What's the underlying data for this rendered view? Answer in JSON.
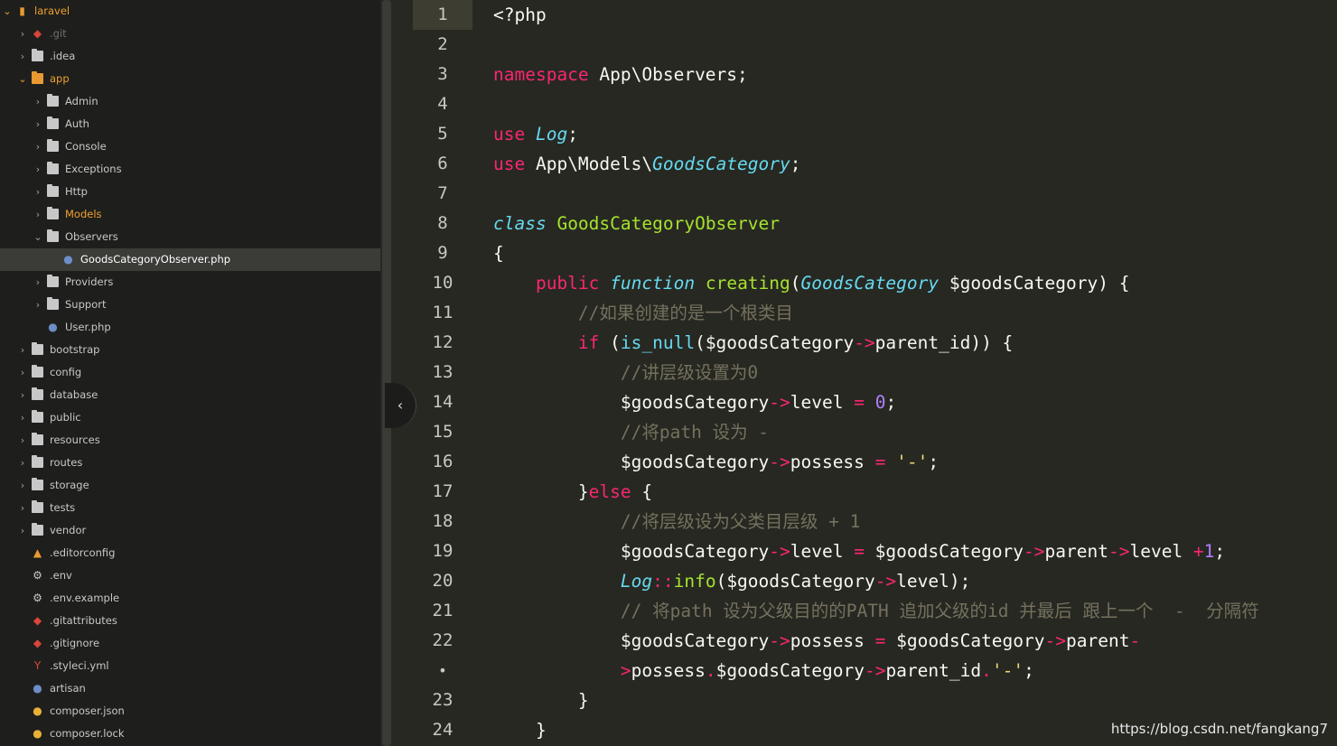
{
  "sidebar": {
    "items": [
      {
        "label": "laravel",
        "arrow": "⌄",
        "icon": "book-icon"
      },
      {
        "label": ".git",
        "arrow": "›",
        "icon": "git-icon"
      },
      {
        "label": ".idea",
        "arrow": "›",
        "icon": "folder-icon"
      },
      {
        "label": "app",
        "arrow": "⌄",
        "icon": "folder-open-icon"
      },
      {
        "label": "Admin",
        "arrow": "›",
        "icon": "folder-icon"
      },
      {
        "label": "Auth",
        "arrow": "›",
        "icon": "folder-icon"
      },
      {
        "label": "Console",
        "arrow": "›",
        "icon": "folder-icon"
      },
      {
        "label": "Exceptions",
        "arrow": "›",
        "icon": "folder-icon"
      },
      {
        "label": "Http",
        "arrow": "›",
        "icon": "folder-icon"
      },
      {
        "label": "Models",
        "arrow": "›",
        "icon": "folder-icon"
      },
      {
        "label": "Observers",
        "arrow": "⌄",
        "icon": "folder-icon"
      },
      {
        "label": "GoodsCategoryObserver.php",
        "arrow": "",
        "icon": "php-elephant-icon"
      },
      {
        "label": "Providers",
        "arrow": "›",
        "icon": "folder-icon"
      },
      {
        "label": "Support",
        "arrow": "›",
        "icon": "folder-icon"
      },
      {
        "label": "User.php",
        "arrow": "",
        "icon": "php-elephant-icon"
      },
      {
        "label": "bootstrap",
        "arrow": "›",
        "icon": "folder-icon"
      },
      {
        "label": "config",
        "arrow": "›",
        "icon": "folder-icon"
      },
      {
        "label": "database",
        "arrow": "›",
        "icon": "folder-icon"
      },
      {
        "label": "public",
        "arrow": "›",
        "icon": "folder-icon"
      },
      {
        "label": "resources",
        "arrow": "›",
        "icon": "folder-icon"
      },
      {
        "label": "routes",
        "arrow": "›",
        "icon": "folder-icon"
      },
      {
        "label": "storage",
        "arrow": "›",
        "icon": "folder-icon"
      },
      {
        "label": "tests",
        "arrow": "›",
        "icon": "folder-icon"
      },
      {
        "label": "vendor",
        "arrow": "›",
        "icon": "folder-icon"
      },
      {
        "label": ".editorconfig",
        "arrow": "",
        "icon": "editorconfig-icon"
      },
      {
        "label": ".env",
        "arrow": "",
        "icon": "gear-icon"
      },
      {
        "label": ".env.example",
        "arrow": "",
        "icon": "gear-icon"
      },
      {
        "label": ".gitattributes",
        "arrow": "",
        "icon": "git-icon"
      },
      {
        "label": ".gitignore",
        "arrow": "",
        "icon": "git-icon"
      },
      {
        "label": ".styleci.yml",
        "arrow": "",
        "icon": "yaml-icon"
      },
      {
        "label": "artisan",
        "arrow": "",
        "icon": "php-elephant-icon"
      },
      {
        "label": "composer.json",
        "arrow": "",
        "icon": "composer-icon"
      },
      {
        "label": "composer.lock",
        "arrow": "",
        "icon": "composer-icon"
      }
    ]
  },
  "editor": {
    "line_numbers": [
      "1",
      "2",
      "3",
      "4",
      "5",
      "6",
      "7",
      "8",
      "9",
      "10",
      "11",
      "12",
      "13",
      "14",
      "15",
      "16",
      "17",
      "18",
      "19",
      "20",
      "21",
      "22",
      "•",
      "23",
      "24"
    ],
    "lines": [
      [
        {
          "t": "<?php",
          "c": ""
        }
      ],
      [],
      [
        {
          "t": "namespace",
          "c": "kw"
        },
        {
          "t": " App\\Observers;",
          "c": ""
        }
      ],
      [],
      [
        {
          "t": "use",
          "c": "kw"
        },
        {
          "t": " ",
          "c": ""
        },
        {
          "t": "Log",
          "c": "st"
        },
        {
          "t": ";",
          "c": ""
        }
      ],
      [
        {
          "t": "use",
          "c": "kw"
        },
        {
          "t": " App\\Models\\",
          "c": ""
        },
        {
          "t": "GoodsCategory",
          "c": "st"
        },
        {
          "t": ";",
          "c": ""
        }
      ],
      [],
      [
        {
          "t": "class",
          "c": "st"
        },
        {
          "t": " ",
          "c": ""
        },
        {
          "t": "GoodsCategoryObserver",
          "c": "cl"
        }
      ],
      [
        {
          "t": "{",
          "c": ""
        }
      ],
      [
        {
          "t": "    ",
          "c": ""
        },
        {
          "t": "public",
          "c": "kw"
        },
        {
          "t": " ",
          "c": ""
        },
        {
          "t": "function",
          "c": "st"
        },
        {
          "t": " ",
          "c": ""
        },
        {
          "t": "creating",
          "c": "fn"
        },
        {
          "t": "(",
          "c": ""
        },
        {
          "t": "GoodsCategory",
          "c": "st"
        },
        {
          "t": " $goodsCategory) {",
          "c": ""
        }
      ],
      [
        {
          "t": "        ",
          "c": ""
        },
        {
          "t": "//如果创建的是一个根类目",
          "c": "cm"
        }
      ],
      [
        {
          "t": "        ",
          "c": ""
        },
        {
          "t": "if",
          "c": "kw"
        },
        {
          "t": " (",
          "c": ""
        },
        {
          "t": "is_null",
          "c": "bi"
        },
        {
          "t": "($goodsCategory",
          "c": ""
        },
        {
          "t": "->",
          "c": "op"
        },
        {
          "t": "parent_id)) {",
          "c": ""
        }
      ],
      [
        {
          "t": "            ",
          "c": ""
        },
        {
          "t": "//讲层级设置为0",
          "c": "cm"
        }
      ],
      [
        {
          "t": "            $goodsCategory",
          "c": ""
        },
        {
          "t": "->",
          "c": "op"
        },
        {
          "t": "level ",
          "c": ""
        },
        {
          "t": "=",
          "c": "op"
        },
        {
          "t": " ",
          "c": ""
        },
        {
          "t": "0",
          "c": "nm"
        },
        {
          "t": ";",
          "c": ""
        }
      ],
      [
        {
          "t": "            ",
          "c": ""
        },
        {
          "t": "//将path 设为 -",
          "c": "cm"
        }
      ],
      [
        {
          "t": "            $goodsCategory",
          "c": ""
        },
        {
          "t": "->",
          "c": "op"
        },
        {
          "t": "possess ",
          "c": ""
        },
        {
          "t": "=",
          "c": "op"
        },
        {
          "t": " ",
          "c": ""
        },
        {
          "t": "'-'",
          "c": "sr"
        },
        {
          "t": ";",
          "c": ""
        }
      ],
      [
        {
          "t": "        }",
          "c": ""
        },
        {
          "t": "else",
          "c": "kw"
        },
        {
          "t": " {",
          "c": ""
        }
      ],
      [
        {
          "t": "            ",
          "c": ""
        },
        {
          "t": "//将层级设为父类目层级 + 1",
          "c": "cm"
        }
      ],
      [
        {
          "t": "            $goodsCategory",
          "c": ""
        },
        {
          "t": "->",
          "c": "op"
        },
        {
          "t": "level ",
          "c": ""
        },
        {
          "t": "=",
          "c": "op"
        },
        {
          "t": " $goodsCategory",
          "c": ""
        },
        {
          "t": "->",
          "c": "op"
        },
        {
          "t": "parent",
          "c": ""
        },
        {
          "t": "->",
          "c": "op"
        },
        {
          "t": "level ",
          "c": ""
        },
        {
          "t": "+",
          "c": "op"
        },
        {
          "t": "1",
          "c": "nm"
        },
        {
          "t": ";",
          "c": ""
        }
      ],
      [
        {
          "t": "            ",
          "c": ""
        },
        {
          "t": "Log",
          "c": "st"
        },
        {
          "t": "::",
          "c": "op"
        },
        {
          "t": "info",
          "c": "fn"
        },
        {
          "t": "($goodsCategory",
          "c": ""
        },
        {
          "t": "->",
          "c": "op"
        },
        {
          "t": "level);",
          "c": ""
        }
      ],
      [
        {
          "t": "            ",
          "c": ""
        },
        {
          "t": "// 将path 设为父级目的的PATH 追加父级的id 并最后 跟上一个  -  分隔符",
          "c": "cm"
        }
      ],
      [
        {
          "t": "            $goodsCategory",
          "c": ""
        },
        {
          "t": "->",
          "c": "op"
        },
        {
          "t": "possess ",
          "c": ""
        },
        {
          "t": "=",
          "c": "op"
        },
        {
          "t": " $goodsCategory",
          "c": ""
        },
        {
          "t": "->",
          "c": "op"
        },
        {
          "t": "parent",
          "c": ""
        },
        {
          "t": "-",
          "c": "op"
        }
      ],
      [
        {
          "t": "            ",
          "c": ""
        },
        {
          "t": ">",
          "c": "op"
        },
        {
          "t": "possess",
          "c": ""
        },
        {
          "t": ".",
          "c": "op"
        },
        {
          "t": "$goodsCategory",
          "c": ""
        },
        {
          "t": "->",
          "c": "op"
        },
        {
          "t": "parent_id",
          "c": ""
        },
        {
          "t": ".",
          "c": "op"
        },
        {
          "t": "'-'",
          "c": "sr"
        },
        {
          "t": ";",
          "c": ""
        }
      ],
      [
        {
          "t": "        }",
          "c": ""
        }
      ],
      [
        {
          "t": "    }",
          "c": ""
        }
      ]
    ]
  },
  "collapse_button": {
    "glyph": "‹"
  },
  "watermark": {
    "text": "https://blog.csdn.net/fangkang7"
  }
}
